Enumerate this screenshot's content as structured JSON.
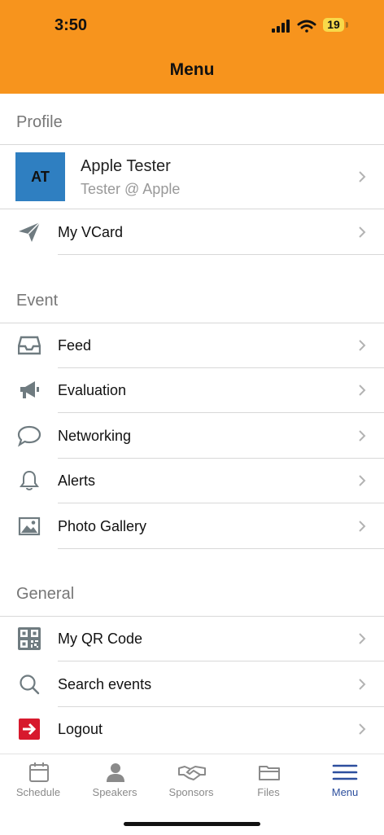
{
  "status": {
    "time": "3:50",
    "battery": "19"
  },
  "header": {
    "title": "Menu"
  },
  "profile": {
    "section_title": "Profile",
    "initials": "AT",
    "name": "Apple Tester",
    "subtitle": "Tester @ Apple",
    "vcard_label": "My VCard"
  },
  "event": {
    "section_title": "Event",
    "items": [
      {
        "label": "Feed",
        "icon": "inbox-icon"
      },
      {
        "label": "Evaluation",
        "icon": "megaphone-icon"
      },
      {
        "label": "Networking",
        "icon": "chat-bubble-icon"
      },
      {
        "label": "Alerts",
        "icon": "bell-icon"
      },
      {
        "label": "Photo Gallery",
        "icon": "image-icon"
      }
    ]
  },
  "general": {
    "section_title": "General",
    "items": [
      {
        "label": "My QR Code",
        "icon": "qr-code-icon"
      },
      {
        "label": "Search events",
        "icon": "search-icon"
      },
      {
        "label": "Logout",
        "icon": "logout-icon"
      }
    ]
  },
  "tabs": [
    {
      "label": "Schedule",
      "icon": "calendar-icon"
    },
    {
      "label": "Speakers",
      "icon": "person-icon"
    },
    {
      "label": "Sponsors",
      "icon": "handshake-icon"
    },
    {
      "label": "Files",
      "icon": "folder-icon"
    },
    {
      "label": "Menu",
      "icon": "menu-icon",
      "active": true
    }
  ],
  "colors": {
    "header": "#f7941d",
    "avatar": "#2f7fc1",
    "active_tab": "#2d4f9e",
    "logout": "#d7192d"
  }
}
